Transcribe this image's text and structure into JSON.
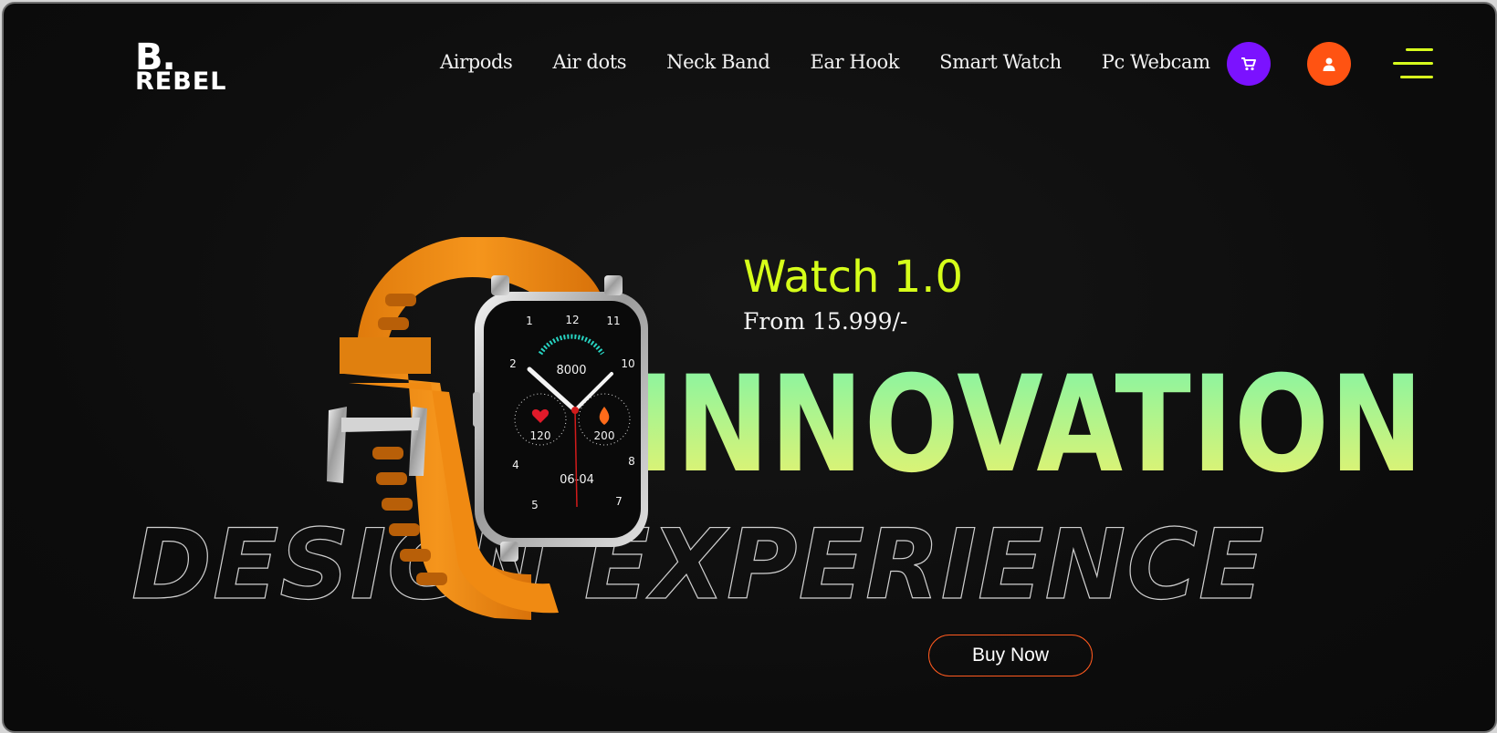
{
  "brand": {
    "logo_top": "B.",
    "logo_word": "REBEL"
  },
  "nav": {
    "items": [
      {
        "label": "Airpods"
      },
      {
        "label": "Air dots"
      },
      {
        "label": "Neck Band"
      },
      {
        "label": "Ear Hook"
      },
      {
        "label": "Smart Watch"
      },
      {
        "label": "Pc Webcam"
      }
    ]
  },
  "header_actions": {
    "cart_icon": "cart-icon",
    "user_icon": "user-icon",
    "menu_icon": "hamburger-icon"
  },
  "hero": {
    "product_name": "Watch 1.0",
    "price_text": "From 15.999/-",
    "headline": "INNOVATION",
    "outline_text": "DESIGN EXPERIENCE",
    "cta_label": "Buy Now"
  },
  "watch_face": {
    "steps": "8000",
    "heart_rate": "120",
    "calories": "200",
    "date": "06-04",
    "numerals": [
      "12",
      "1",
      "2",
      "4",
      "5",
      "7",
      "8",
      "10",
      "11"
    ]
  },
  "colors": {
    "accent_lime": "#d6ff1a",
    "cart_purple": "#7b12ff",
    "user_orange": "#ff5312",
    "cta_border": "#ff5a1f",
    "strap_orange": "#f08a12",
    "headline_gradient": [
      "#7cf5a8",
      "#f0f26a"
    ]
  }
}
